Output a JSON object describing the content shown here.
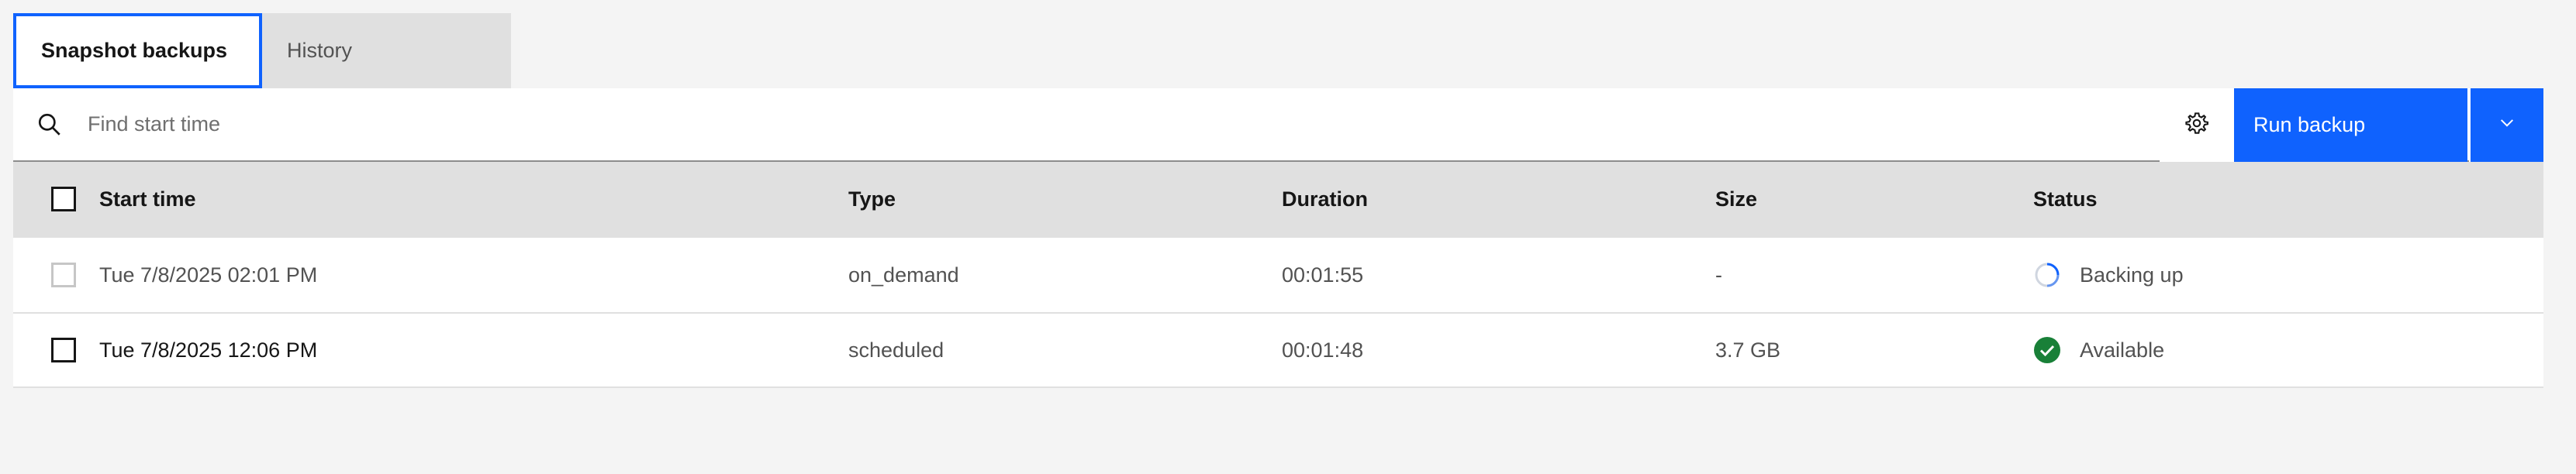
{
  "tabs": [
    {
      "label": "Snapshot backups",
      "active": true
    },
    {
      "label": "History",
      "active": false
    }
  ],
  "toolbar": {
    "search_placeholder": "Find start time",
    "run_backup_label": "Run backup",
    "settings_icon": "gear-icon",
    "split_icon": "chevron-down-icon"
  },
  "table": {
    "columns": [
      "Start time",
      "Type",
      "Duration",
      "Size",
      "Status"
    ],
    "rows": [
      {
        "start_time": "Tue 7/8/2025 02:01 PM",
        "type": "on_demand",
        "duration": "00:01:55",
        "size": "-",
        "status": "Backing up",
        "status_icon": "loading-spinner-icon",
        "checkbox_enabled": false
      },
      {
        "start_time": "Tue 7/8/2025 12:06 PM",
        "type": "scheduled",
        "duration": "00:01:48",
        "size": "3.7 GB",
        "status": "Available",
        "status_icon": "checkmark-filled-icon",
        "checkbox_enabled": true
      }
    ]
  },
  "colors": {
    "accent": "#0f62fe",
    "success": "#24a148",
    "success_dark": "#198038"
  }
}
